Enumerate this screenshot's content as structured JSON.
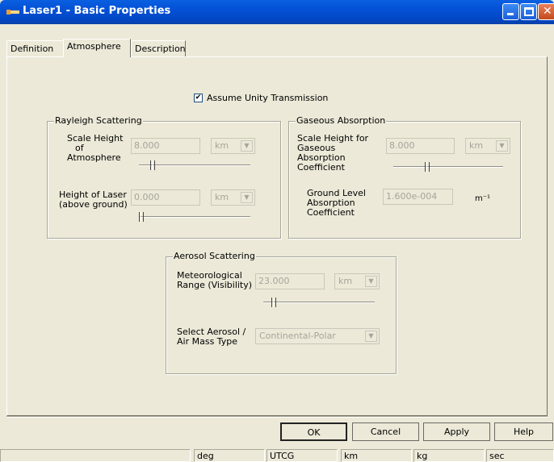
{
  "window": {
    "title": "Laser1 - Basic Properties",
    "icon": "laser-icon"
  },
  "title_buttons": {
    "minimize": "minimize-icon",
    "maximize": "maximize-icon",
    "close": "close-icon"
  },
  "tabs": [
    {
      "label": "Definition"
    },
    {
      "label": "Atmosphere",
      "active": true
    },
    {
      "label": "Description"
    }
  ],
  "unity": {
    "label": "Assume Unity Transmission",
    "checked": true
  },
  "rayleigh": {
    "title": "Rayleigh Scattering",
    "scale_height": {
      "label_lines": [
        "Scale Height",
        "of",
        "Atmosphere"
      ],
      "value": "8.000",
      "unit": "km"
    },
    "height_laser": {
      "label_lines": [
        "Height of Laser",
        "(above ground)"
      ],
      "value": "0.000",
      "unit": "km"
    }
  },
  "gaseous": {
    "title": "Gaseous Absorption",
    "scale_height": {
      "label_lines": [
        "Scale Height for",
        "Gaseous Absorption",
        "Coefficient"
      ],
      "value": "8.000",
      "unit": "km"
    },
    "ground": {
      "label_lines": [
        "Ground Level",
        "Absorption",
        "Coefficient"
      ],
      "value": "1.600e-004",
      "unit": "m⁻¹"
    }
  },
  "aerosol": {
    "title": "Aerosol Scattering",
    "range": {
      "label_lines": [
        "Meteorological",
        "Range (Visibility)"
      ],
      "value": "23.000",
      "unit": "km"
    },
    "type": {
      "label_lines": [
        "Select Aerosol /",
        "Air Mass Type"
      ],
      "value": "Continental-Polar"
    }
  },
  "buttons": {
    "ok": "OK",
    "cancel": "Cancel",
    "apply": "Apply",
    "help": "Help"
  },
  "status": [
    "",
    "deg",
    "UTCG",
    "km",
    "kg",
    "sec"
  ],
  "colors": {
    "titlebar": "#0451d6",
    "face": "#ece9d8",
    "disabled_text": "#a6a49a"
  }
}
